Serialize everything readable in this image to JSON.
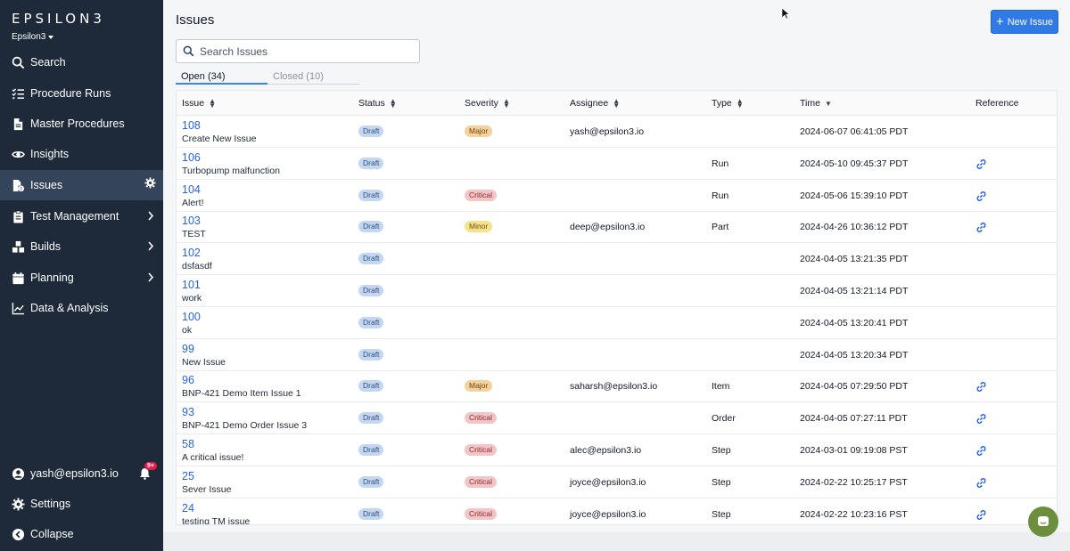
{
  "brand": {
    "logo_text": "EPSILON3",
    "workspace": "Epsilon3"
  },
  "sidebar": {
    "items": [
      {
        "label": "Search",
        "icon": "search-icon"
      },
      {
        "label": "Procedure Runs",
        "icon": "list-check-icon"
      },
      {
        "label": "Master Procedures",
        "icon": "document-icon"
      },
      {
        "label": "Insights",
        "icon": "eye-icon"
      },
      {
        "label": "Issues",
        "icon": "issue-doc-icon",
        "active": true
      },
      {
        "label": "Test Management",
        "icon": "clipboard-icon"
      },
      {
        "label": "Builds",
        "icon": "cubes-icon"
      },
      {
        "label": "Planning",
        "icon": "calendar-icon"
      },
      {
        "label": "Data & Analysis",
        "icon": "chart-line-icon"
      }
    ],
    "user": "yash@epsilon3.io",
    "notification_badge": "9+",
    "settings_label": "Settings",
    "collapse_label": "Collapse"
  },
  "header": {
    "title": "Issues",
    "new_issue_label": "New Issue"
  },
  "search": {
    "placeholder": "Search Issues"
  },
  "tabs": {
    "open": "Open (34)",
    "closed": "Closed (10)"
  },
  "table": {
    "columns": [
      "Issue",
      "Status",
      "Severity",
      "Assignee",
      "Type",
      "Time",
      "Reference"
    ],
    "rows": [
      {
        "id": "108",
        "title": "Create New Issue",
        "status": "Draft",
        "severity": "Major",
        "assignee": "yash@epsilon3.io",
        "type": "",
        "time": "2024-06-07 06:41:05 PDT",
        "reference": false
      },
      {
        "id": "106",
        "title": "Turbopump malfunction",
        "status": "Draft",
        "severity": "",
        "assignee": "",
        "type": "Run",
        "time": "2024-05-10 09:45:37 PDT",
        "reference": true
      },
      {
        "id": "104",
        "title": "Alert!",
        "status": "Draft",
        "severity": "Critical",
        "assignee": "",
        "type": "Run",
        "time": "2024-05-06 15:39:10 PDT",
        "reference": true
      },
      {
        "id": "103",
        "title": "TEST",
        "status": "Draft",
        "severity": "Minor",
        "assignee": "deep@epsilon3.io",
        "type": "Part",
        "time": "2024-04-26 10:36:12 PDT",
        "reference": true
      },
      {
        "id": "102",
        "title": "dsfasdf",
        "status": "Draft",
        "severity": "",
        "assignee": "",
        "type": "",
        "time": "2024-04-05 13:21:35 PDT",
        "reference": false
      },
      {
        "id": "101",
        "title": "work",
        "status": "Draft",
        "severity": "",
        "assignee": "",
        "type": "",
        "time": "2024-04-05 13:21:14 PDT",
        "reference": false
      },
      {
        "id": "100",
        "title": "ok",
        "status": "Draft",
        "severity": "",
        "assignee": "",
        "type": "",
        "time": "2024-04-05 13:20:41 PDT",
        "reference": false
      },
      {
        "id": "99",
        "title": "New Issue",
        "status": "Draft",
        "severity": "",
        "assignee": "",
        "type": "",
        "time": "2024-04-05 13:20:34 PDT",
        "reference": false
      },
      {
        "id": "96",
        "title": "BNP-421 Demo Item Issue 1",
        "status": "Draft",
        "severity": "Major",
        "assignee": "saharsh@epsilon3.io",
        "type": "Item",
        "time": "2024-04-05 07:29:50 PDT",
        "reference": true
      },
      {
        "id": "93",
        "title": "BNP-421 Demo Order Issue 3",
        "status": "Draft",
        "severity": "Critical",
        "assignee": "",
        "type": "Order",
        "time": "2024-04-05 07:27:11 PDT",
        "reference": true
      },
      {
        "id": "58",
        "title": "A critical issue!",
        "status": "Draft",
        "severity": "Critical",
        "assignee": "alec@epsilon3.io",
        "type": "Step",
        "time": "2024-03-01 09:19:08 PST",
        "reference": true
      },
      {
        "id": "25",
        "title": "Sever Issue",
        "status": "Draft",
        "severity": "Critical",
        "assignee": "joyce@epsilon3.io",
        "type": "Step",
        "time": "2024-02-22 10:25:17 PST",
        "reference": true
      },
      {
        "id": "24",
        "title": "testing TM issue",
        "status": "Draft",
        "severity": "Critical",
        "assignee": "joyce@epsilon3.io",
        "type": "Step",
        "time": "2024-02-22 10:23:16 PST",
        "reference": true
      }
    ]
  },
  "colors": {
    "accent": "#2f7ae5",
    "sidebar_bg": "#1e2a3a",
    "active_item": "#34445a",
    "chat": "#6b8f3d"
  }
}
